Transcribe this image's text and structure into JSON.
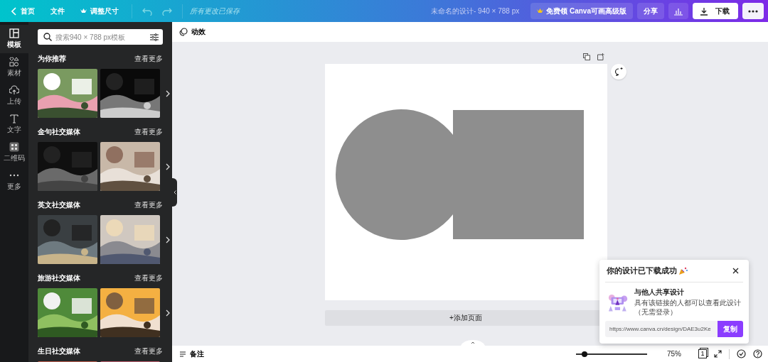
{
  "topbar": {
    "back": "首页",
    "file": "文件",
    "resize": "调整尺寸",
    "saved": "所有更改已保存",
    "title": "未命名的设计- 940 × 788 px",
    "upgrade": "免费领 Canva可画高级版",
    "share": "分享",
    "download": "下载"
  },
  "rail": [
    {
      "kind": "templates",
      "label": "模板",
      "selected": true
    },
    {
      "kind": "elements",
      "label": "素材",
      "selected": false
    },
    {
      "kind": "uploads",
      "label": "上传",
      "selected": false
    },
    {
      "kind": "text",
      "label": "文字",
      "selected": false
    },
    {
      "kind": "qrcode",
      "label": "二维码",
      "selected": false
    },
    {
      "kind": "more",
      "label": "更多",
      "selected": false
    }
  ],
  "panel": {
    "search": {
      "placeholder": "搜索940 × 788 px模板"
    },
    "sections": [
      {
        "title": "为你推荐",
        "more": "查看更多"
      },
      {
        "title": "金句社交媒体",
        "more": "查看更多"
      },
      {
        "title": "英文社交媒体",
        "more": "查看更多"
      },
      {
        "title": "旅游社交媒体",
        "more": "查看更多"
      },
      {
        "title": "生日社交媒体",
        "more": "查看更多"
      }
    ]
  },
  "toolbar": {
    "animate": "动效"
  },
  "canvas": {
    "shapes": [
      {
        "kind": "circle",
        "color": "#8e8e8e"
      },
      {
        "kind": "square",
        "color": "#8e8e8e"
      }
    ],
    "add_page": "+添加页面"
  },
  "popup": {
    "title": "你的设计已下载成功",
    "heading": "与他人共享设计",
    "body": "具有该链接的人都可以查看此设计（无需登录）",
    "link": "https://www.canva.cn/design/DAE3u2Ke",
    "copy": "复制"
  },
  "bottombar": {
    "notes": "备注",
    "zoom": {
      "level": 0.12
    },
    "zoom_reading": "75%",
    "page_count": "1"
  }
}
